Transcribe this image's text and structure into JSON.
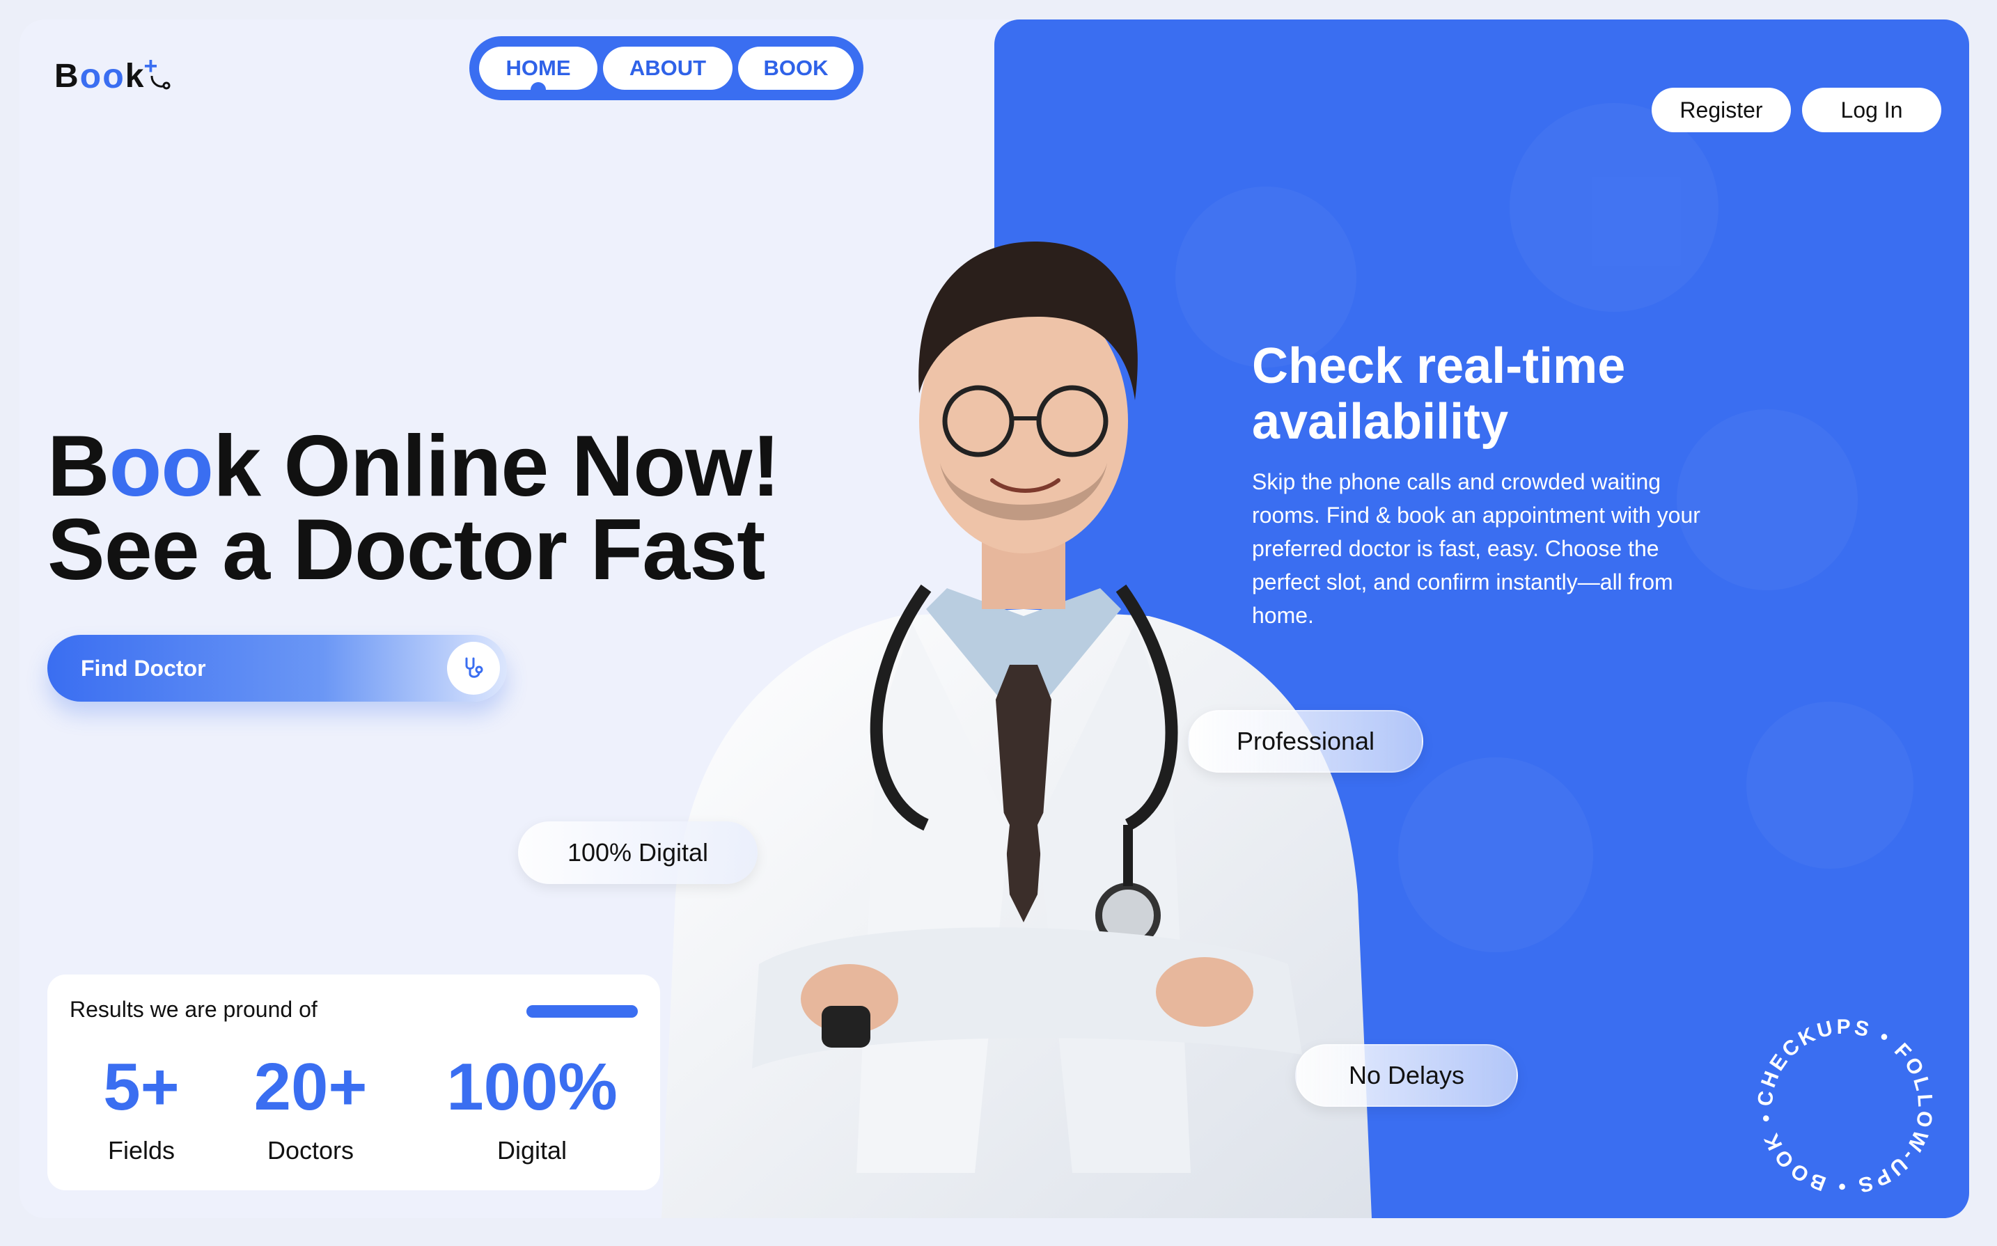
{
  "logo": {
    "b": "B",
    "oo": "oo",
    "k": "k",
    "plus": "+"
  },
  "nav": {
    "home": "HOME",
    "about": "ABOUT",
    "book": "BOOK"
  },
  "auth": {
    "register": "Register",
    "login": "Log In"
  },
  "hero": {
    "b": "B",
    "oo": "oo",
    "rest1": "k Online Now!",
    "line2": "See a Doctor Fast"
  },
  "find_doctor": {
    "label": "Find Doctor"
  },
  "pills": {
    "digital": "100% Digital",
    "professional": "Professional",
    "no_delays": "No Delays"
  },
  "right": {
    "title": "Check real-time availability",
    "body": "Skip the phone calls and crowded waiting rooms. Find & book an appointment with your preferred doctor is fast, easy. Choose the perfect slot, and confirm instantly—all from home."
  },
  "results": {
    "label": "Results we are pround of",
    "stats": [
      {
        "value": "5+",
        "caption": "Fields"
      },
      {
        "value": "20+",
        "caption": "Doctors"
      },
      {
        "value": "100%",
        "caption": "Digital"
      }
    ]
  },
  "badge": {
    "text": "CHECKUPS • FOLLOW-UPS • BOOK •"
  },
  "colors": {
    "accent": "#3a6ef1",
    "background": "#eef1fc",
    "text": "#111111"
  },
  "icons": {
    "find": "stethoscope-icon",
    "logo": "stethoscope-icon"
  }
}
